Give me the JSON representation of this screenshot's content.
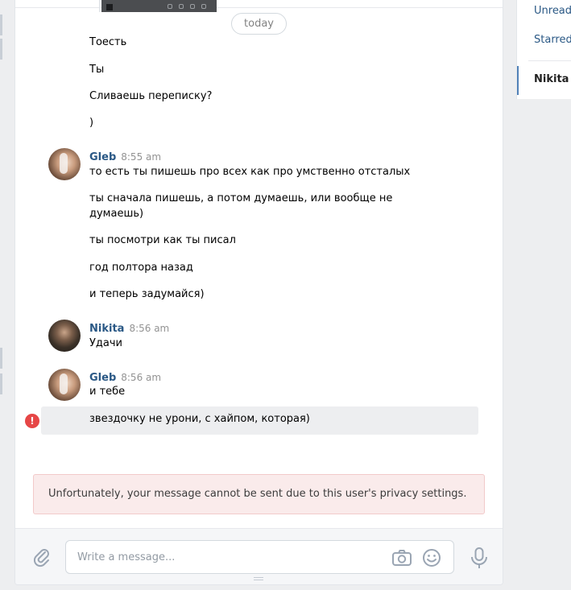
{
  "day_separator": "today",
  "messages_initial": [
    "Тоесть",
    "Ты",
    "Сливаешь переписку?",
    ")"
  ],
  "groups": [
    {
      "author": "Gleb",
      "time": "8:55 am",
      "lines": [
        "то есть ты пишешь про всех как про умственно отсталых",
        "ты сначала пишешь, а потом думаешь, или вообще не",
        "думаешь)",
        "ты посмотри как ты писал",
        "год полтора назад",
        "и теперь задумайся)"
      ]
    },
    {
      "author": "Nikita",
      "time": "8:56 am",
      "lines": [
        "Удачи"
      ]
    },
    {
      "author": "Gleb",
      "time": "8:56 am",
      "lines": [
        "и тебе"
      ]
    }
  ],
  "failed_message": {
    "text": "звездочку не урони, с хайпом, которая)",
    "error_glyph": "!"
  },
  "privacy_notice": "Unfortunately, your message cannot be sent due to this user's privacy settings.",
  "composer": {
    "placeholder": "Write a message..."
  },
  "right_panel": {
    "items": [
      "Unread",
      "Starred"
    ],
    "active_conversation": "Nikita K"
  },
  "colors": {
    "link": "#2a5885",
    "error": "#e64646",
    "notice_bg": "#faebeb",
    "highlight_bg": "#edeef0"
  }
}
